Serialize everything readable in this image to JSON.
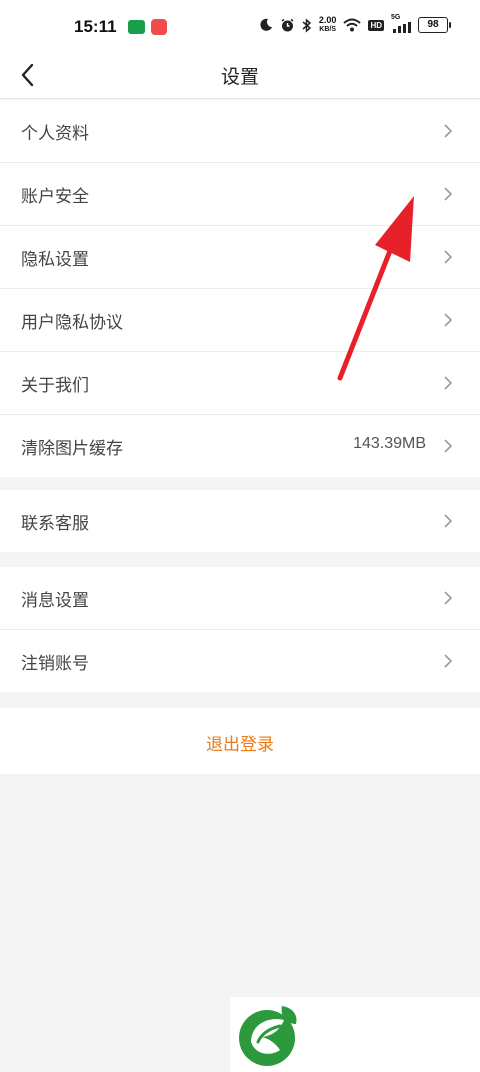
{
  "status_bar": {
    "time": "15:11",
    "net_speed_value": "2.00",
    "net_speed_unit": "KB/S",
    "hd_label": "HD",
    "signal_label": "5G",
    "battery": "98"
  },
  "header": {
    "title": "设置",
    "back_icon": "chevron-left-icon"
  },
  "groups": [
    {
      "items": [
        {
          "label": "个人资料"
        },
        {
          "label": "账户安全"
        },
        {
          "label": "隐私设置"
        },
        {
          "label": "用户隐私协议"
        },
        {
          "label": "关于我们"
        },
        {
          "label": "清除图片缓存",
          "value": "143.39MB"
        }
      ]
    },
    {
      "items": [
        {
          "label": "联系客服"
        }
      ]
    },
    {
      "items": [
        {
          "label": "消息设置"
        },
        {
          "label": "注销账号"
        }
      ]
    }
  ],
  "logout": {
    "label": "退出登录"
  },
  "colors": {
    "accent": "#ec7a18",
    "annotation_arrow": "#e8202a",
    "logo_green": "#2c9a3c",
    "background": "#f4f4f4"
  }
}
